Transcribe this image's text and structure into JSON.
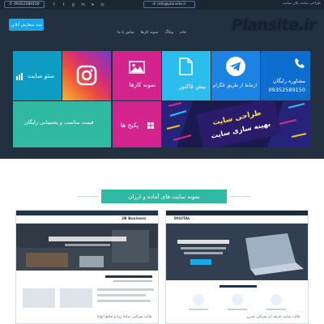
{
  "header": {
    "tagline": "طراحی سایت پلان سایت",
    "phone": "09352589150",
    "email": "info@plansite.ir",
    "logo": "Plansite.ir",
    "order_button": "ثبت سفارش آنلاین",
    "nav": [
      "خانه",
      "وبلاگ",
      "نمونه کارها",
      "تماس با ما"
    ]
  },
  "socials": [
    "facebook",
    "twitter",
    "google-plus",
    "linkedin",
    "telegram",
    "instagram"
  ],
  "tiles": {
    "consult_line1": "مشاوره رایگان",
    "consult_line2": "09352589150",
    "telegram": "ارتباط از طریق تلگرام",
    "invoice": "پیش فاکتور",
    "portfolio": "نمونه کارها",
    "seo": "سئو سایت",
    "support": "قیمت مناسب و پشتیبانی رایگان",
    "packages": "پکیج ها",
    "banner_line1": "طراحی سایت",
    "banner_line2": "بهینه سازی سایت"
  },
  "section": {
    "title": "نمونه سایت های آماده و ارزان"
  },
  "previews": {
    "left_caption": "قالب شرکتی ساده زیبا و جامع انواع",
    "left_brand": "2B Business",
    "right_caption": "قالب سایت حرفه ای شرکتی مدرن",
    "right_brand": "DIGITAL"
  },
  "colors": {
    "header_bg": "#22303f",
    "accent_teal": "#2fb8a2",
    "accent_pink": "#d3238d",
    "accent_blue": "#0d6ecf",
    "accent_sky": "#2abded",
    "order_button": "#1aa7e8"
  }
}
